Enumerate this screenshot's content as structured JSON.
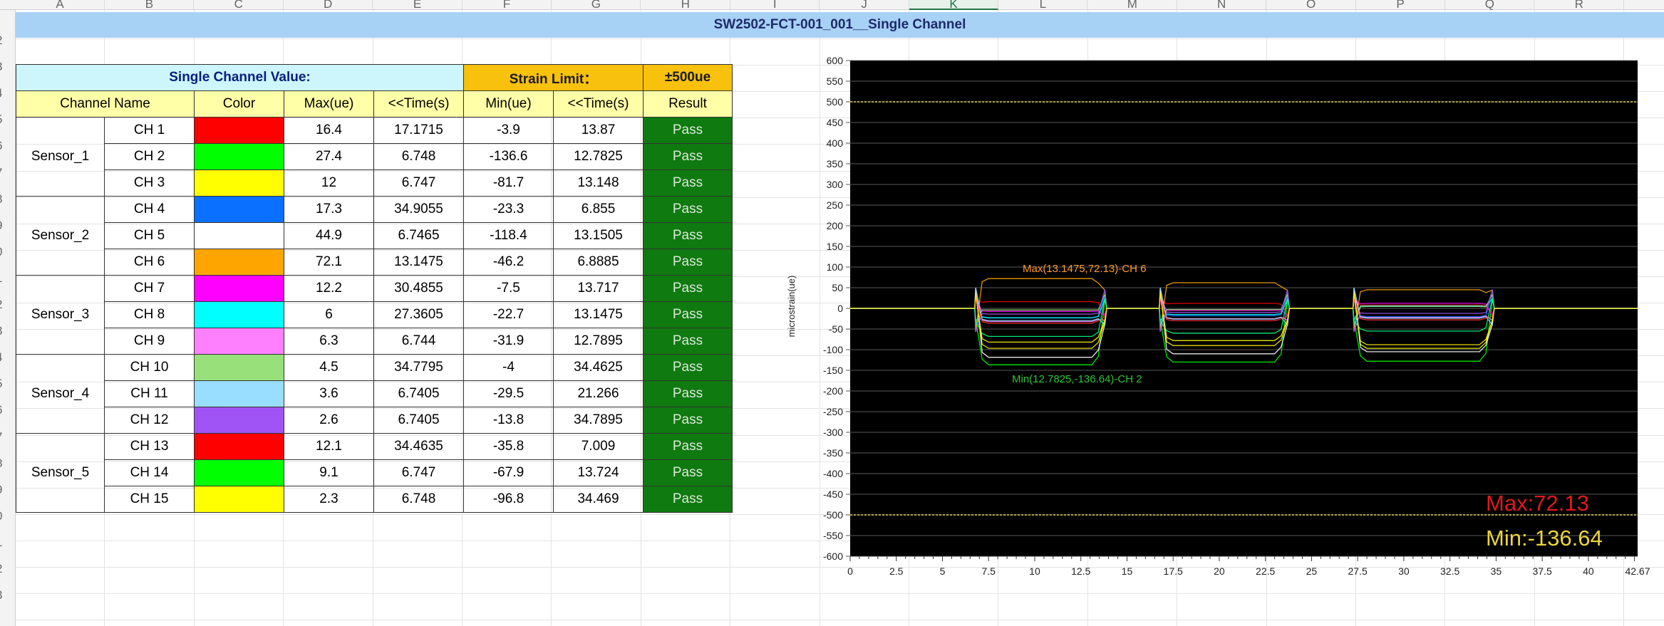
{
  "sheet": {
    "columns": [
      "A",
      "B",
      "C",
      "D",
      "E",
      "F",
      "G",
      "H",
      "I",
      "J",
      "K",
      "L",
      "M",
      "N",
      "O",
      "P",
      "Q",
      "R"
    ],
    "active_column": "K",
    "rows": [
      "2",
      "3",
      "4",
      "5",
      "6",
      "7",
      "8",
      "9",
      "0",
      "1",
      "2",
      "3",
      "4",
      "5",
      "6",
      "7",
      "8",
      "9",
      "0",
      "1",
      "2",
      "3"
    ]
  },
  "title": "SW2502-FCT-001_001__Single Channel",
  "table": {
    "group_header": "Single Channel Value:",
    "strain_limit_label": "Strain Limit：",
    "strain_limit_value": "±500ue",
    "headers": [
      "Channel Name",
      "Color",
      "Max(ue)",
      "<<Time(s)",
      "Min(ue)",
      "<<Time(s)",
      "Result"
    ],
    "sensors": [
      "Sensor_1",
      "Sensor_2",
      "Sensor_3",
      "Sensor_4",
      "Sensor_5"
    ],
    "rows": [
      {
        "ch": "CH 1",
        "color": "#ff0000",
        "max": "16.4",
        "tmax": "17.1715",
        "min": "-3.9",
        "tmin": "13.87",
        "result": "Pass"
      },
      {
        "ch": "CH 2",
        "color": "#00ff00",
        "max": "27.4",
        "tmax": "6.748",
        "min": "-136.6",
        "tmin": "12.7825",
        "result": "Pass"
      },
      {
        "ch": "CH 3",
        "color": "#ffff00",
        "max": "12",
        "tmax": "6.747",
        "min": "-81.7",
        "tmin": "13.148",
        "result": "Pass"
      },
      {
        "ch": "CH 4",
        "color": "#0a70ff",
        "max": "17.3",
        "tmax": "34.9055",
        "min": "-23.3",
        "tmin": "6.855",
        "result": "Pass"
      },
      {
        "ch": "CH 5",
        "color": "#ffffff",
        "max": "44.9",
        "tmax": "6.7465",
        "min": "-118.4",
        "tmin": "13.1505",
        "result": "Pass"
      },
      {
        "ch": "CH 6",
        "color": "#ffa500",
        "max": "72.1",
        "tmax": "13.1475",
        "min": "-46.2",
        "tmin": "6.8885",
        "result": "Pass"
      },
      {
        "ch": "CH 7",
        "color": "#ff00ff",
        "max": "12.2",
        "tmax": "30.4855",
        "min": "-7.5",
        "tmin": "13.717",
        "result": "Pass"
      },
      {
        "ch": "CH 8",
        "color": "#00ffff",
        "max": "6",
        "tmax": "27.3605",
        "min": "-22.7",
        "tmin": "13.1475",
        "result": "Pass"
      },
      {
        "ch": "CH 9",
        "color": "#ff80ff",
        "max": "6.3",
        "tmax": "6.744",
        "min": "-31.9",
        "tmin": "12.7895",
        "result": "Pass"
      },
      {
        "ch": "CH 10",
        "color": "#98e07a",
        "max": "4.5",
        "tmax": "34.7795",
        "min": "-4",
        "tmin": "34.4625",
        "result": "Pass"
      },
      {
        "ch": "CH 11",
        "color": "#99ddff",
        "max": "3.6",
        "tmax": "6.7405",
        "min": "-29.5",
        "tmin": "21.266",
        "result": "Pass"
      },
      {
        "ch": "CH 12",
        "color": "#a054f5",
        "max": "2.6",
        "tmax": "6.7405",
        "min": "-13.8",
        "tmin": "34.7895",
        "result": "Pass"
      },
      {
        "ch": "CH 13",
        "color": "#ff0000",
        "max": "12.1",
        "tmax": "34.4635",
        "min": "-35.8",
        "tmin": "7.009",
        "result": "Pass"
      },
      {
        "ch": "CH 14",
        "color": "#00ff00",
        "max": "9.1",
        "tmax": "6.747",
        "min": "-67.9",
        "tmin": "13.724",
        "result": "Pass"
      },
      {
        "ch": "CH 15",
        "color": "#ffff00",
        "max": "2.3",
        "tmax": "6.748",
        "min": "-96.8",
        "tmin": "34.469",
        "result": "Pass"
      }
    ]
  },
  "chart_data": {
    "type": "line",
    "title": "",
    "xlabel": "",
    "ylabel": "microstrain(ue)",
    "xlim": [
      0,
      42.67
    ],
    "ylim": [
      -600,
      600
    ],
    "x_ticks": [
      "0",
      "2.5",
      "5",
      "7.5",
      "10",
      "12.5",
      "15",
      "17.5",
      "20",
      "22.5",
      "25",
      "27.5",
      "30",
      "32.5",
      "35",
      "37.5",
      "40",
      "42.67"
    ],
    "y_ticks": [
      600,
      550,
      500,
      450,
      400,
      350,
      300,
      250,
      200,
      150,
      100,
      50,
      0,
      -50,
      -100,
      -150,
      -200,
      -250,
      -300,
      -350,
      -400,
      -450,
      -500,
      -550,
      -600
    ],
    "grid": true,
    "background": "#000000",
    "limit_lines": [
      500,
      -500
    ],
    "limit_color": "#e6d85a",
    "max_annotation": {
      "text": "Max(13.1475,72.13)-CH 6",
      "x": 13.1475,
      "y": 72.13,
      "color": "#ff9a2e"
    },
    "min_annotation": {
      "text": "Min(12.7825,-136.64)-CH 2",
      "x": 12.7825,
      "y": -136.64,
      "color": "#2ec43a"
    },
    "summary_max": {
      "text": "Max:72.13",
      "color": "#e0191e"
    },
    "summary_min": {
      "text": "Min:-136.64",
      "color": "#ecd53b"
    },
    "pulses": [
      [
        6.8,
        13.8
      ],
      [
        16.8,
        23.7
      ],
      [
        27.3,
        34.8
      ]
    ],
    "series": [
      {
        "color": "#ff0000",
        "levels": [
          16.4,
          12,
          8
        ]
      },
      {
        "color": "#00ff00",
        "levels": [
          -136.6,
          -130,
          -128
        ]
      },
      {
        "color": "#ffff00",
        "levels": [
          -81.7,
          -78,
          -96.8
        ]
      },
      {
        "color": "#0a70ff",
        "levels": [
          -23.3,
          -18,
          -20
        ]
      },
      {
        "color": "#ffffff",
        "levels": [
          -118.4,
          -110,
          -105
        ]
      },
      {
        "color": "#ffa500",
        "levels": [
          72.1,
          62,
          45
        ]
      },
      {
        "color": "#ff00ff",
        "levels": [
          -7.5,
          -5,
          12.2
        ]
      },
      {
        "color": "#00ffff",
        "levels": [
          -22.7,
          -15,
          6
        ]
      },
      {
        "color": "#ff80ff",
        "levels": [
          -31.9,
          -25,
          -22
        ]
      },
      {
        "color": "#98e07a",
        "levels": [
          -4,
          -3,
          4.5
        ]
      },
      {
        "color": "#99ddff",
        "levels": [
          -29.5,
          -26,
          -24
        ]
      },
      {
        "color": "#a054f5",
        "levels": [
          -13.8,
          -10,
          -12
        ]
      },
      {
        "color": "#ff3030",
        "levels": [
          -35.8,
          -30,
          -28
        ]
      },
      {
        "color": "#00ff80",
        "levels": [
          -67.9,
          -60,
          -55
        ]
      },
      {
        "color": "#ffee00",
        "levels": [
          -96.8,
          -90,
          -88
        ]
      }
    ]
  }
}
